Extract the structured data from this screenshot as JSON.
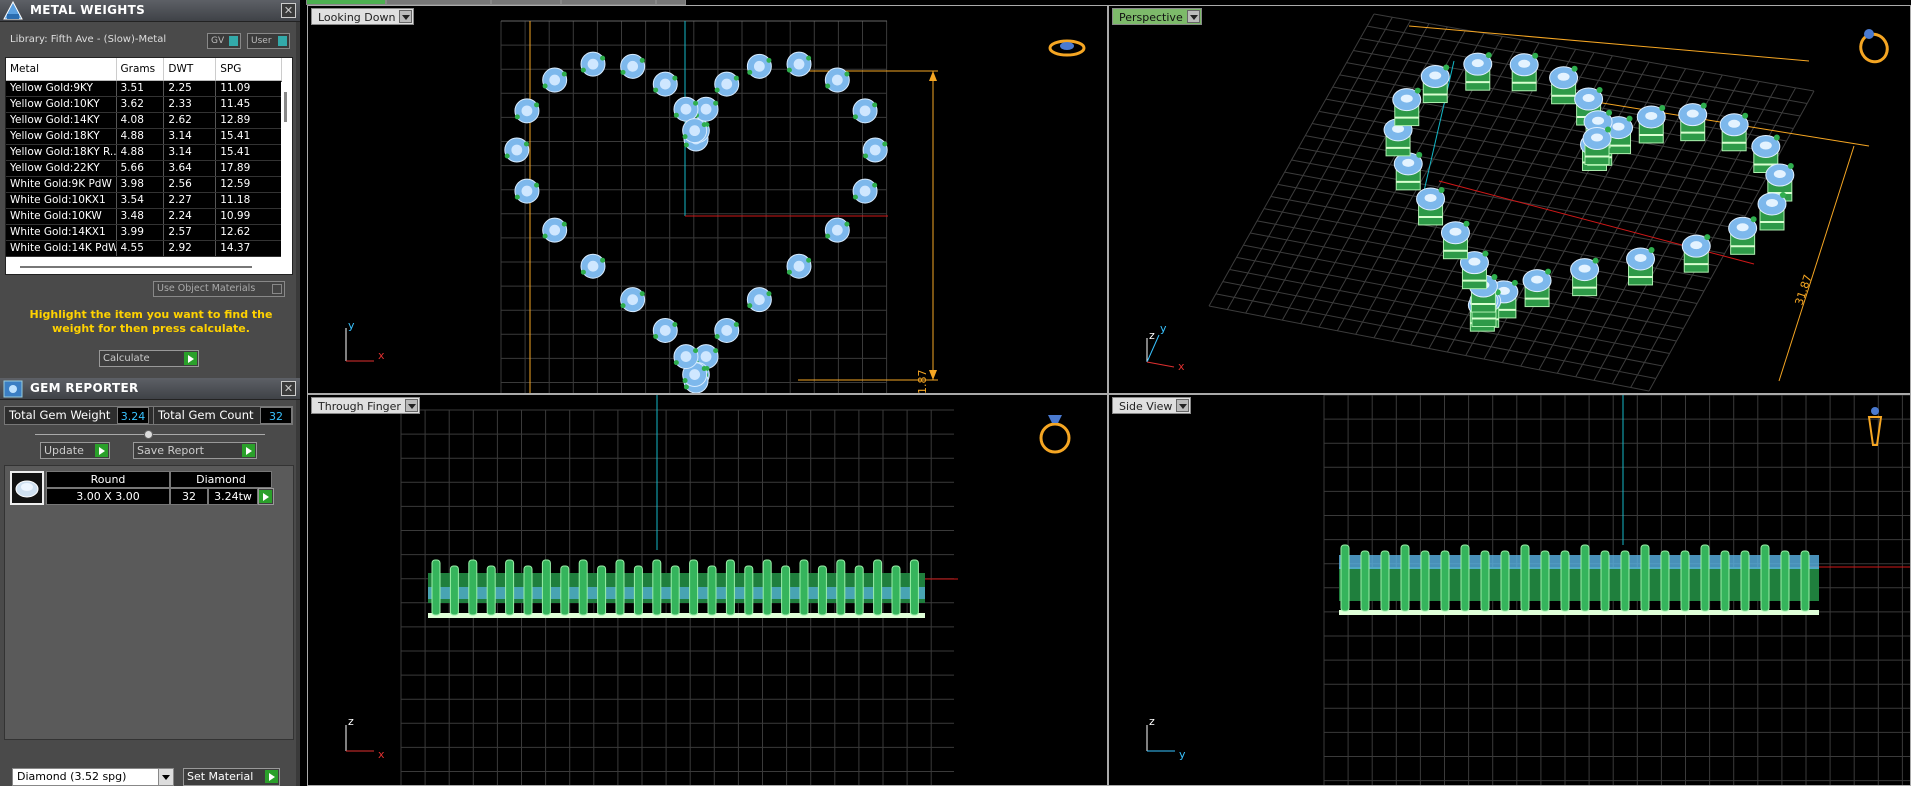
{
  "metal_weights": {
    "title": "METAL WEIGHTS",
    "library": "Library: Fifth Ave - (Slow)-Metal",
    "toggle_gv": "GV",
    "toggle_user": "User",
    "columns": [
      "Metal",
      "Grams",
      "DWT",
      "SPG"
    ],
    "rows": [
      [
        "Yellow Gold:9KY",
        "3.51",
        "2.25",
        "11.09"
      ],
      [
        "Yellow Gold:10KY",
        "3.62",
        "2.33",
        "11.45"
      ],
      [
        "Yellow Gold:14KY",
        "4.08",
        "2.62",
        "12.89"
      ],
      [
        "Yellow Gold:18KY",
        "4.88",
        "3.14",
        "15.41"
      ],
      [
        "Yellow Gold:18KY R...",
        "4.88",
        "3.14",
        "15.41"
      ],
      [
        "Yellow Gold:22KY",
        "5.66",
        "3.64",
        "17.89"
      ],
      [
        "White Gold:9K PdW",
        "3.98",
        "2.56",
        "12.59"
      ],
      [
        "White Gold:10KX1",
        "3.54",
        "2.27",
        "11.18"
      ],
      [
        "White Gold:10KW",
        "3.48",
        "2.24",
        "10.99"
      ],
      [
        "White Gold:14KX1",
        "3.99",
        "2.57",
        "12.62"
      ],
      [
        "White Gold:14K PdW",
        "4.55",
        "2.92",
        "14.37"
      ]
    ],
    "use_object_materials": "Use Object Materials",
    "hint": "Highlight the item you want to find the weight for then press calculate.",
    "calculate": "Calculate"
  },
  "gem_reporter": {
    "title": "GEM REPORTER",
    "total_weight_label": "Total Gem Weight",
    "total_weight_value": "3.24",
    "total_count_label": "Total Gem Count",
    "total_count_value": "32",
    "update": "Update",
    "save_report": "Save Report",
    "gem": {
      "shape": "Round",
      "material": "Diamond",
      "size": "3.00 X 3.00",
      "count": "32",
      "weight": "3.24tw"
    },
    "material_select": "Diamond     (3.52 spg)",
    "set_material": "Set Material"
  },
  "viewports": {
    "top_left": {
      "label": "Looking Down",
      "axis_a": "y",
      "axis_b": "x",
      "dim": "31.87"
    },
    "top_right": {
      "label": "Perspective",
      "axis_a": "z",
      "axis_b": "y",
      "axis_c": "x",
      "dim": "31.87"
    },
    "bottom_left": {
      "label": "Through Finger",
      "axis_a": "z",
      "axis_b": "x"
    },
    "bottom_right": {
      "label": "Side View",
      "axis_a": "z",
      "axis_b": "y"
    }
  },
  "colors": {
    "accent_yellow": "#ffd200",
    "gem_blue": "#8fc6f5",
    "prong_green": "#2fae4e",
    "dimension_orange": "#f5a623",
    "axis_red": "#d01818",
    "axis_cyan": "#14b9c8"
  }
}
